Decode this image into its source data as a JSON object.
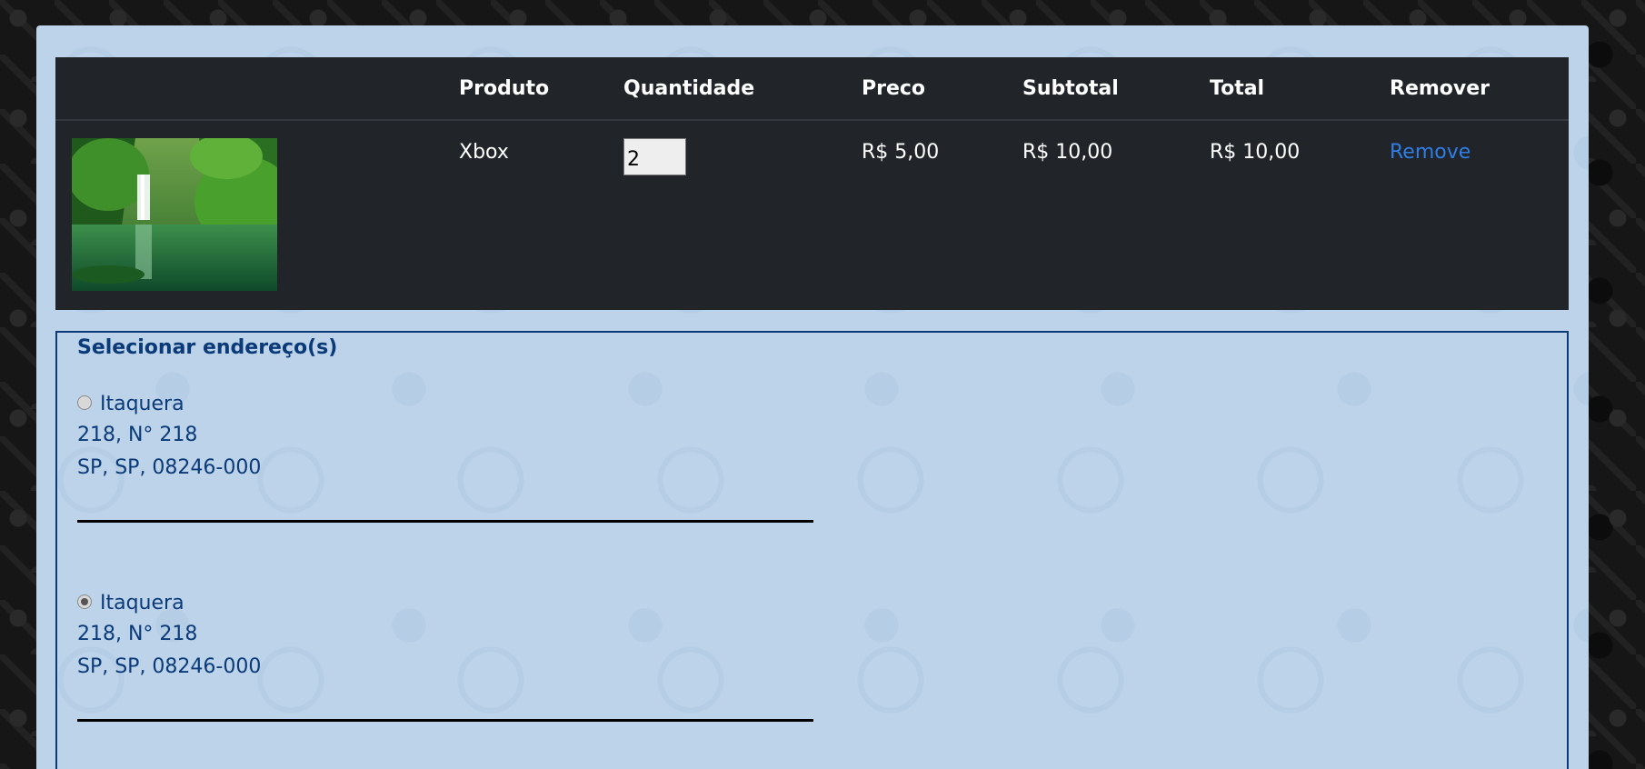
{
  "cart": {
    "columns": [
      "Produto",
      "Quantidade",
      "Preco",
      "Subtotal",
      "Total",
      "Remover"
    ],
    "rows": [
      {
        "image": "waterfall-forest-photo",
        "product": "Xbox",
        "quantity": "2",
        "price": "R$ 5,00",
        "subtotal": "R$ 10,00",
        "total": "R$ 10,00",
        "remove_label": "Remove"
      }
    ]
  },
  "addresses": {
    "legend": "Selecionar endereço(s)",
    "items": [
      {
        "name": "Itaquera",
        "line1": "218, N° 218",
        "line2": "SP, SP, 08246-000",
        "selected": false
      },
      {
        "name": "Itaquera",
        "line1": "218, N° 218",
        "line2": "SP, SP, 08246-000",
        "selected": true
      }
    ]
  },
  "colors": {
    "panel": "#bcd3ea",
    "table": "#212529",
    "link": "#2f7de6",
    "address_text": "#0b3a78"
  }
}
